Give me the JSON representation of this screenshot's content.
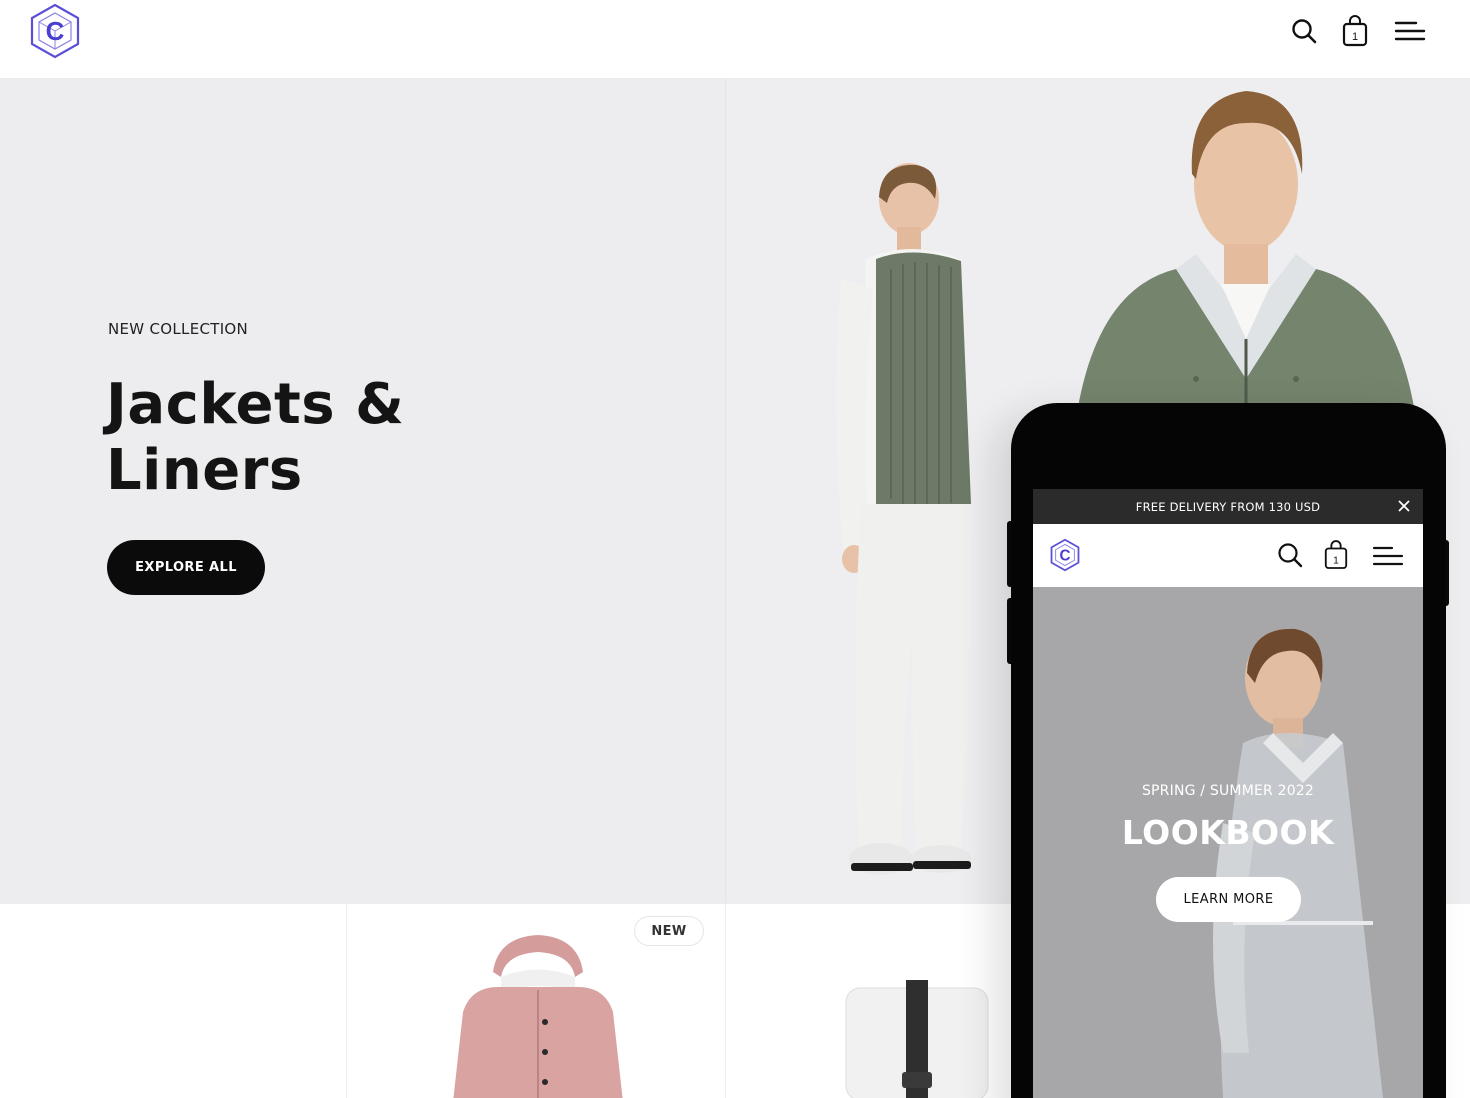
{
  "header": {
    "logo_letter": "C",
    "cart_count": "1",
    "icons": [
      "search-icon",
      "bag-icon",
      "menu-icon"
    ]
  },
  "hero": {
    "eyebrow": "NEW COLLECTION",
    "title_line1": "Jackets &",
    "title_line2": "Liners",
    "cta_label": "EXPLORE ALL"
  },
  "products": {
    "badge": "NEW"
  },
  "phone": {
    "announcement": "FREE DELIVERY FROM 130 USD",
    "cart_count": "1",
    "lookbook": {
      "subtitle": "SPRING / SUMMER 2022",
      "title": "LOOKBOOK",
      "cta_label": "LEARN MORE"
    }
  },
  "colors": {
    "brand": "#5a4fd6",
    "hero_bg": "#ededef",
    "button_dark": "#0b0b0b",
    "jacket_green": "#6b7a63",
    "jacket_pink": "#d8a1a0"
  }
}
